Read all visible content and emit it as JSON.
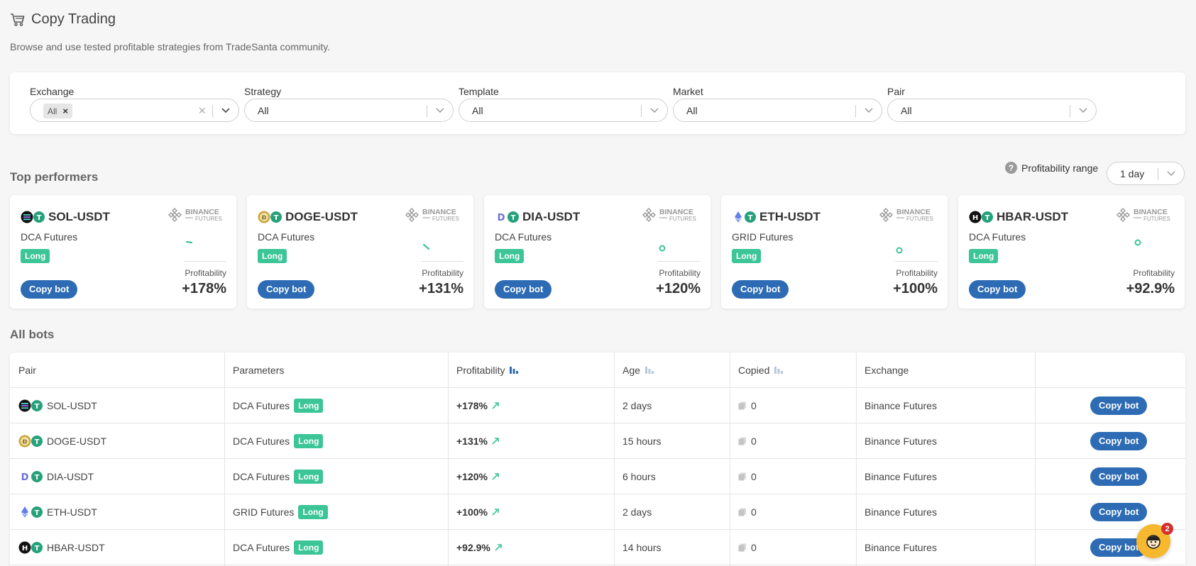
{
  "header": {
    "title": "Copy Trading",
    "subtitle": "Browse and use tested profitable strategies from TradeSanta community."
  },
  "filters": [
    {
      "label": "Exchange",
      "chip": "All"
    },
    {
      "label": "Strategy",
      "value": "All"
    },
    {
      "label": "Template",
      "value": "All"
    },
    {
      "label": "Market",
      "value": "All"
    },
    {
      "label": "Pair",
      "value": "All"
    }
  ],
  "top_performers": {
    "title": "Top performers",
    "range_label": "Profitability range",
    "range_value": "1 day",
    "profitability_label": "Profitability",
    "badge": "Long",
    "copy_label": "Copy bot",
    "cards": [
      {
        "pair": "SOL-USDT",
        "strategy": "DCA Futures",
        "profit": "+178%",
        "base_coin": "sol-icon"
      },
      {
        "pair": "DOGE-USDT",
        "strategy": "DCA Futures",
        "profit": "+131%",
        "base_coin": "doge-icon"
      },
      {
        "pair": "DIA-USDT",
        "strategy": "DCA Futures",
        "profit": "+120%",
        "base_coin": "dia-icon"
      },
      {
        "pair": "ETH-USDT",
        "strategy": "GRID Futures",
        "profit": "+100%",
        "base_coin": "eth-icon"
      },
      {
        "pair": "HBAR-USDT",
        "strategy": "DCA Futures",
        "profit": "+92.9%",
        "base_coin": "hbar-icon"
      }
    ]
  },
  "all_bots": {
    "title": "All bots",
    "columns": [
      "Pair",
      "Parameters",
      "Profitability",
      "Age",
      "Copied",
      "Exchange"
    ],
    "rows": [
      {
        "pair": "SOL-USDT",
        "params": "DCA Futures",
        "badge": "Long",
        "profit": "+178%",
        "age": "2 days",
        "copied": "0",
        "exchange": "Binance Futures",
        "action": "Copy bot"
      },
      {
        "pair": "DOGE-USDT",
        "params": "DCA Futures",
        "badge": "Long",
        "profit": "+131%",
        "age": "15 hours",
        "copied": "0",
        "exchange": "Binance Futures",
        "action": "Copy bot"
      },
      {
        "pair": "DIA-USDT",
        "params": "DCA Futures",
        "badge": "Long",
        "profit": "+120%",
        "age": "6 hours",
        "copied": "0",
        "exchange": "Binance Futures",
        "action": "Copy bot"
      },
      {
        "pair": "ETH-USDT",
        "params": "GRID Futures",
        "badge": "Long",
        "profit": "+100%",
        "age": "2 days",
        "copied": "0",
        "exchange": "Binance Futures",
        "action": "Copy bot"
      },
      {
        "pair": "HBAR-USDT",
        "params": "DCA Futures",
        "badge": "Long",
        "profit": "+92.9%",
        "age": "14 hours",
        "copied": "0",
        "exchange": "Binance Futures",
        "action": "Copy bot"
      }
    ]
  },
  "exchange_logo": {
    "line1": "BINANCE",
    "line2": "FUTURES"
  },
  "chat": {
    "badge_count": "2"
  },
  "colors": {
    "accent": "#2d6cb4",
    "long_badge": "#3cc596",
    "tether": "#26a17b"
  }
}
